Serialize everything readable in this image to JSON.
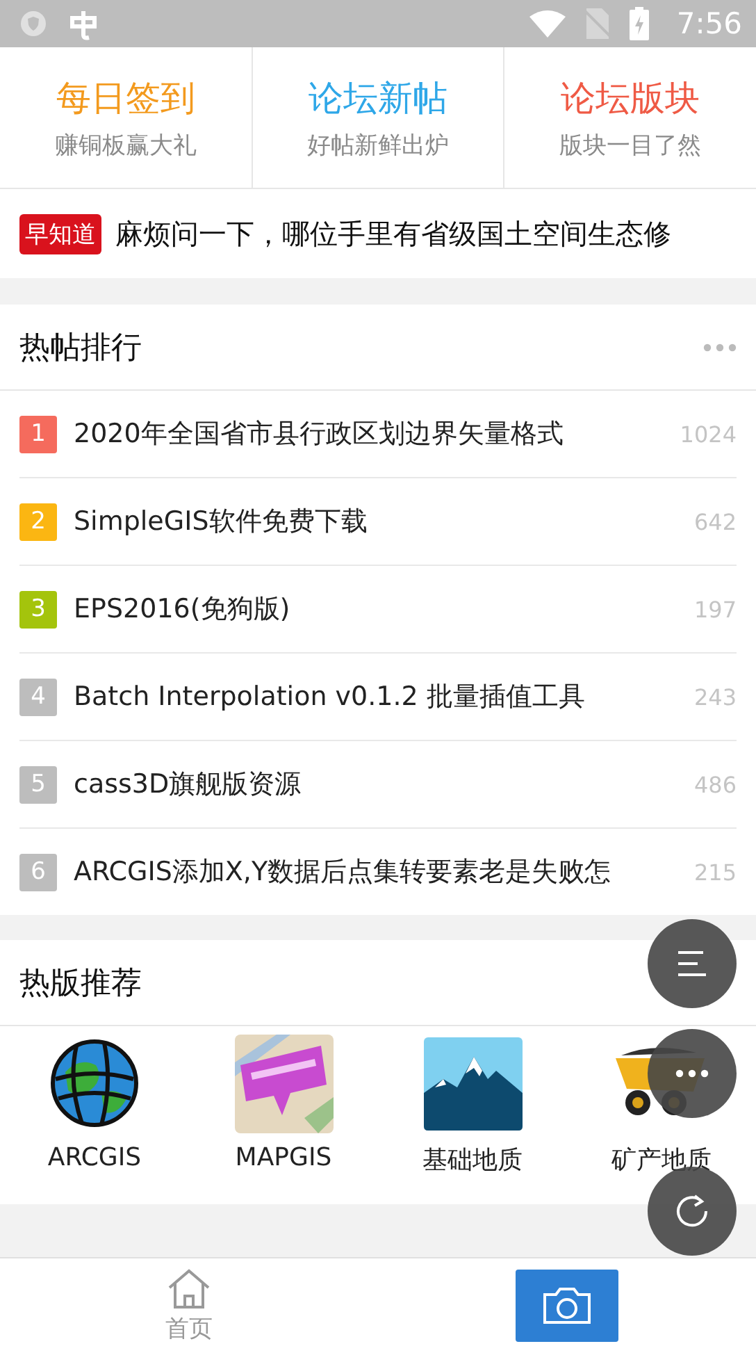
{
  "status_bar": {
    "time": "7:56"
  },
  "quick_links": [
    {
      "title": "每日签到",
      "subtitle": "赚铜板赢大礼",
      "color": "#f39a1e"
    },
    {
      "title": "论坛新帖",
      "subtitle": "好帖新鲜出炉",
      "color": "#2ea7e8"
    },
    {
      "title": "论坛版块",
      "subtitle": "版块一目了然",
      "color": "#ef5a45"
    }
  ],
  "ticker": {
    "badge": "早知道",
    "text": "麻烦问一下，哪位手里有省级国土空间生态修"
  },
  "hot_posts": {
    "title": "热帖排行",
    "rows": [
      {
        "rank": "1",
        "title": "2020年全国省市县行政区划边界矢量格式",
        "count": "1024",
        "color": "#f56b5d"
      },
      {
        "rank": "2",
        "title": "SimpleGIS软件免费下载",
        "count": "642",
        "color": "#fbb612"
      },
      {
        "rank": "3",
        "title": "EPS2016(免狗版)",
        "count": "197",
        "color": "#a4c40c"
      },
      {
        "rank": "4",
        "title": "Batch Interpolation v0.1.2 批量插值工具",
        "count": "243",
        "color": "#bdbdbd"
      },
      {
        "rank": "5",
        "title": "cass3D旗舰版资源",
        "count": "486",
        "color": "#bdbdbd"
      },
      {
        "rank": "6",
        "title": "ARCGIS添加X,Y数据后点集转要素老是失败怎",
        "count": "215",
        "color": "#bdbdbd"
      }
    ]
  },
  "hot_boards": {
    "title": "热版推荐",
    "items": [
      {
        "label": "ARCGIS",
        "kind": "globe"
      },
      {
        "label": "MAPGIS",
        "kind": "map"
      },
      {
        "label": "基础地质",
        "kind": "mountain"
      },
      {
        "label": "矿产地质",
        "kind": "truck"
      }
    ]
  },
  "bottom_nav": {
    "home_label": "首页"
  }
}
